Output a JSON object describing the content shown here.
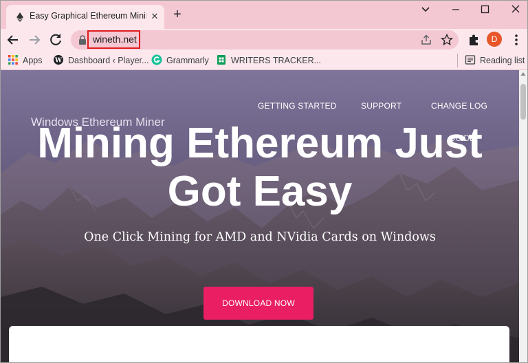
{
  "browser": {
    "tab": {
      "title": "Easy Graphical Ethereum Mining S",
      "close_label": "✕"
    },
    "new_tab_label": "+",
    "url": "wineth.net",
    "avatar_initial": "D",
    "bookmarks": [
      {
        "label": "Apps",
        "icon": "apps-grid-icon"
      },
      {
        "label": "Dashboard ‹ Player...",
        "icon": "wordpress-icon"
      },
      {
        "label": "Grammarly",
        "icon": "grammarly-icon"
      },
      {
        "label": "WRITERS TRACKER...",
        "icon": "sheets-icon"
      }
    ],
    "reading_list": "Reading list"
  },
  "site": {
    "nav": [
      "GETTING STARTED",
      "SUPPORT",
      "CHANGE LOG"
    ],
    "nav_partial": "GUIDE",
    "name": "Windows Ethereum Miner",
    "headline": "Mining Ethereum Just Got Easy",
    "subheadline": "One Click Mining for AMD and NVidia Cards on Windows",
    "cta": "DOWNLOAD NOW"
  },
  "colors": {
    "tabstrip": "#f4c8d3",
    "toolbar": "#fbe7ec",
    "url_highlight": "#e01b1b",
    "cta": "#e91e63",
    "avatar": "#e8562a"
  }
}
